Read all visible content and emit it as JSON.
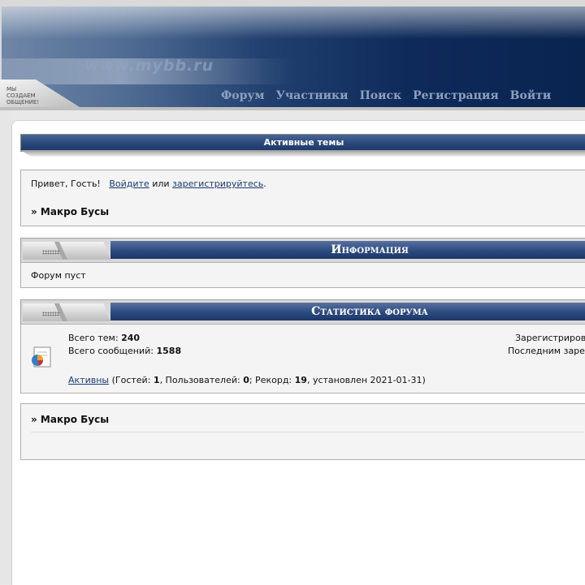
{
  "header": {
    "site_url": "www.mybb.ru",
    "slogan": [
      "мы",
      "создаем",
      "общение!"
    ],
    "nav": [
      "Форум",
      "Участники",
      "Поиск",
      "Регистрация",
      "Войти"
    ]
  },
  "active_topics": {
    "title": "Активные темы"
  },
  "welcome": {
    "greeting": "Привет, Гость!",
    "login_link": "Войдите",
    "or_text": "или",
    "register_link": "зарегистрируйтесь",
    "period": ".",
    "forum_name": "» Макро Бусы"
  },
  "info": {
    "title": "Информация",
    "text": "Форум пуст"
  },
  "stats": {
    "title": "Статистика форума",
    "topics_label": "Всего тем:",
    "topics_value": "240",
    "posts_label": "Всего сообщений:",
    "posts_value": "1588",
    "registered_label": "Зарегистриров",
    "last_registered_label": "Последним зарег",
    "online_link": "Активны",
    "guests_label": "(Гостей:",
    "guests_value": "1",
    "users_label": ", Пользователей:",
    "users_value": "0",
    "record_label": "; Рекорд:",
    "record_value": "19",
    "record_date": ", установлен 2021-01-31)"
  },
  "footer_block": {
    "forum_name": "» Макро Бусы"
  },
  "colors": {
    "header_dark": "#0a2450",
    "bar_blue": "#2a4a7d",
    "link": "#1a3a72",
    "panel": "#f4f4f4"
  }
}
